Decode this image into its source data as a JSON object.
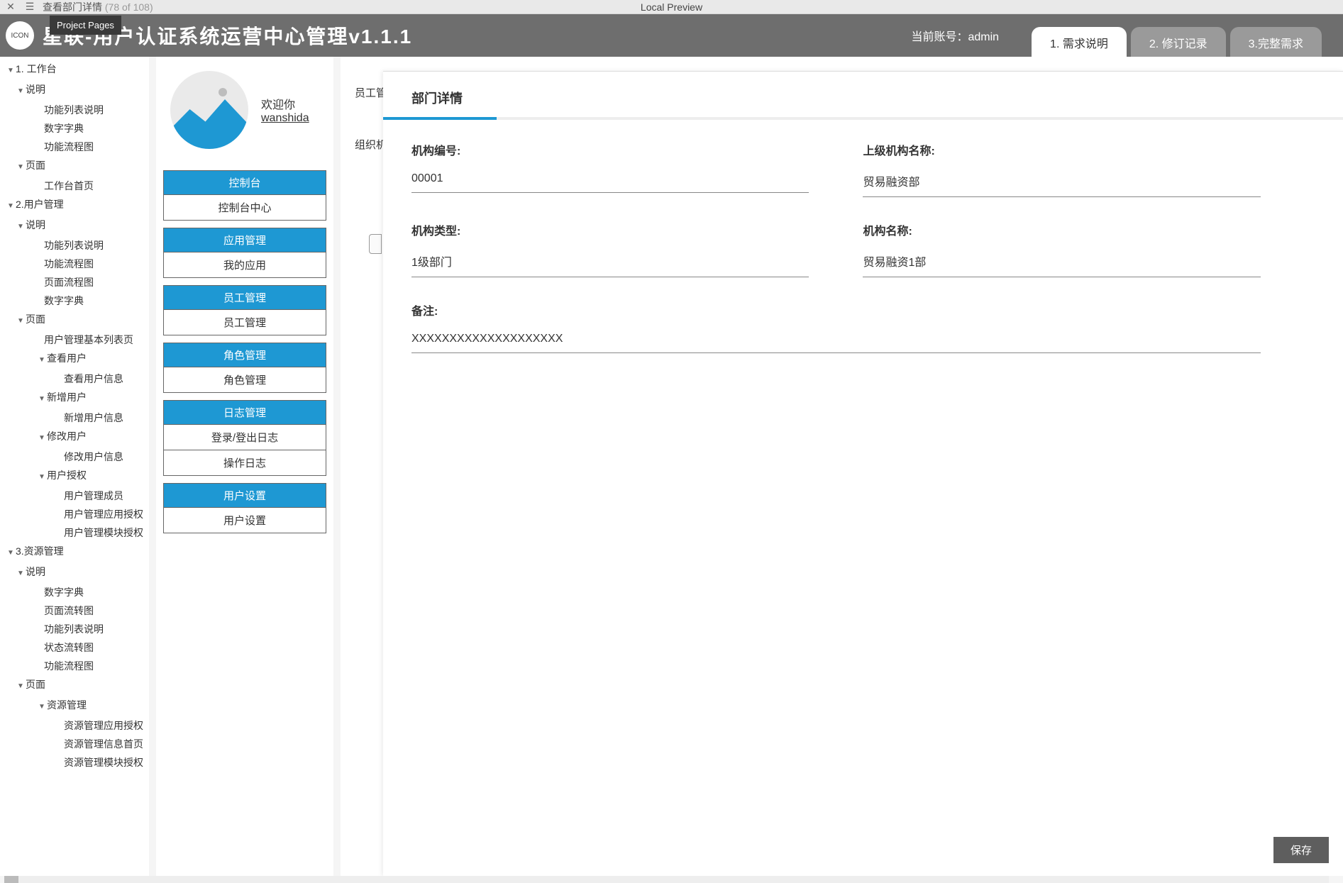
{
  "topStrip": {
    "breadcrumb": "查看部门详情",
    "count": "(78 of 108)",
    "center": "Local Preview"
  },
  "tooltip": "Project Pages",
  "banner": {
    "iconText": "ICON",
    "title": "星联-用户认证系统运营中心管理v1.1.1",
    "accountLabel": "当前账号：",
    "accountValue": "admin",
    "tabs": [
      "1. 需求说明",
      "2. 修订记录",
      "3.完整需求"
    ]
  },
  "tree": [
    {
      "lvl": 1,
      "a": "v",
      "t": "1. 工作台"
    },
    {
      "lvl": 2,
      "a": "v",
      "t": "说明"
    },
    {
      "lvl": 3,
      "a": "",
      "t": "功能列表说明"
    },
    {
      "lvl": 3,
      "a": "",
      "t": "数字字典"
    },
    {
      "lvl": 3,
      "a": "",
      "t": "功能流程图"
    },
    {
      "lvl": 2,
      "a": "v",
      "t": "页面"
    },
    {
      "lvl": 3,
      "a": "",
      "t": "工作台首页"
    },
    {
      "lvl": 1,
      "a": "v",
      "t": "2.用户管理"
    },
    {
      "lvl": 2,
      "a": "v",
      "t": "说明"
    },
    {
      "lvl": 3,
      "a": "",
      "t": "功能列表说明"
    },
    {
      "lvl": 3,
      "a": "",
      "t": "功能流程图"
    },
    {
      "lvl": 3,
      "a": "",
      "t": "页面流程图"
    },
    {
      "lvl": 3,
      "a": "",
      "t": "数字字典"
    },
    {
      "lvl": 2,
      "a": "v",
      "t": "页面"
    },
    {
      "lvl": 3,
      "a": "",
      "t": "用户管理基本列表页"
    },
    {
      "lvl": 4,
      "a": "v",
      "t": "查看用户"
    },
    {
      "lvl": 5,
      "a": "",
      "t": "查看用户信息"
    },
    {
      "lvl": 4,
      "a": "v",
      "t": "新增用户"
    },
    {
      "lvl": 5,
      "a": "",
      "t": "新增用户信息"
    },
    {
      "lvl": 4,
      "a": "v",
      "t": "修改用户"
    },
    {
      "lvl": 5,
      "a": "",
      "t": "修改用户信息"
    },
    {
      "lvl": 4,
      "a": "v",
      "t": "用户授权"
    },
    {
      "lvl": 5,
      "a": "",
      "t": "用户管理成员"
    },
    {
      "lvl": 5,
      "a": "",
      "t": "用户管理应用授权"
    },
    {
      "lvl": 5,
      "a": "",
      "t": "用户管理模块授权"
    },
    {
      "lvl": 1,
      "a": "v",
      "t": "3.资源管理"
    },
    {
      "lvl": 2,
      "a": "v",
      "t": "说明"
    },
    {
      "lvl": 3,
      "a": "",
      "t": "数字字典"
    },
    {
      "lvl": 3,
      "a": "",
      "t": "页面流转图"
    },
    {
      "lvl": 3,
      "a": "",
      "t": "功能列表说明"
    },
    {
      "lvl": 3,
      "a": "",
      "t": "状态流转图"
    },
    {
      "lvl": 3,
      "a": "",
      "t": "功能流程图"
    },
    {
      "lvl": 2,
      "a": "v",
      "t": "页面"
    },
    {
      "lvl": 4,
      "a": "v",
      "t": "资源管理"
    },
    {
      "lvl": 5,
      "a": "",
      "t": "资源管理应用授权"
    },
    {
      "lvl": 5,
      "a": "",
      "t": "资源管理信息首页"
    },
    {
      "lvl": 5,
      "a": "",
      "t": "资源管理模块授权"
    }
  ],
  "sidebar": {
    "hello": "欢迎你",
    "username": "wanshida",
    "groups": [
      {
        "head": "控制台",
        "items": [
          "控制台中心"
        ]
      },
      {
        "head": "应用管理",
        "items": [
          "我的应用"
        ]
      },
      {
        "head": "员工管理",
        "items": [
          "员工管理"
        ]
      },
      {
        "head": "角色管理",
        "items": [
          "角色管理"
        ]
      },
      {
        "head": "日志管理",
        "items": [
          "登录/登出日志",
          "操作日志"
        ]
      },
      {
        "head": "用户设置",
        "items": [
          "用户设置"
        ]
      }
    ]
  },
  "backTabs": {
    "row1": "员工管",
    "row2": "组织机"
  },
  "panel": {
    "title": "部门详情",
    "fields": {
      "orgNoLabel": "机构编号:",
      "orgNo": "00001",
      "parentNameLabel": "上级机构名称:",
      "parentName": "贸易融资部",
      "orgTypeLabel": "机构类型:",
      "orgType": "1级部门",
      "orgNameLabel": "机构名称:",
      "orgName": "贸易融资1部",
      "remarkLabel": "备注:",
      "remark": "XXXXXXXXXXXXXXXXXXXX"
    },
    "saveBtn": "保存"
  }
}
